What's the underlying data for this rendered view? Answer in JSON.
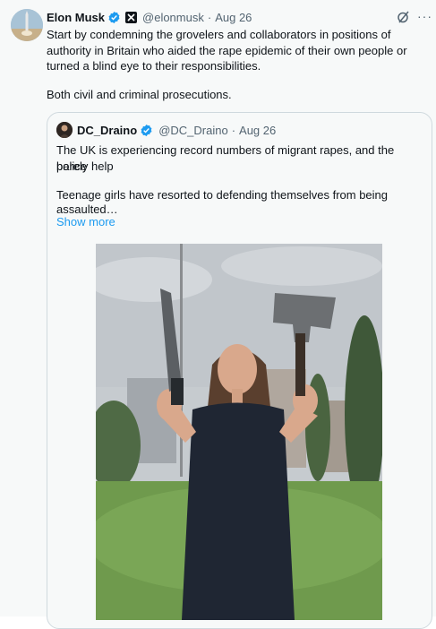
{
  "post": {
    "author_name": "Elon Musk",
    "author_handle": "@elonmusk",
    "separator": "·",
    "date": "Aug 26",
    "text_line_1": "Start by condemning the grovelers and collaborators in positions of",
    "text_line_2": "authority in Britain who aided the rape epidemic of their own people or",
    "text_line_3": "turned a blind eye to their responsibilities.",
    "text_line_4": "Both civil and criminal prosecutions.",
    "more_label": "···"
  },
  "quote": {
    "author_name": "DC_Draino",
    "author_handle": "@DC_Draino",
    "separator": "·",
    "date": "Aug 26",
    "text_line_1": "The UK is experiencing record numbers of migrant rapes, and the police",
    "text_line_2": "barely help",
    "text_line_3": "Teenage girls have resorted to defending themselves from being",
    "text_line_4": "assaulted…",
    "show_more": "Show more"
  },
  "colors": {
    "link": "#1d9bf0",
    "verified": "#1d9bf0",
    "secondary_text": "#536471",
    "border": "#cfd9de"
  },
  "icons": [
    "verified-badge-icon",
    "x-affiliation-icon",
    "grok-icon",
    "more-icon"
  ]
}
